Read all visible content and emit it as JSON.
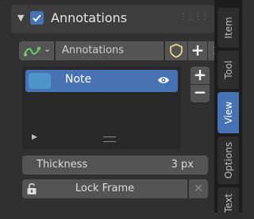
{
  "panel": {
    "title": "Annotations",
    "enabled": true
  },
  "datablock": {
    "name": "Annotations",
    "add_label": "+",
    "remove_label": "✕"
  },
  "layers": {
    "items": [
      {
        "name": "Note",
        "color": "#4e95c9",
        "selected": true,
        "visible": true
      }
    ],
    "add_label": "+",
    "remove_label": "−"
  },
  "thickness": {
    "label": "Thickness",
    "value": "3 px"
  },
  "lock_frame": {
    "label": "Lock Frame"
  },
  "tabs": [
    {
      "label": "Item",
      "active": false
    },
    {
      "label": "Tool",
      "active": false
    },
    {
      "label": "View",
      "active": true
    },
    {
      "label": "Options",
      "active": false
    },
    {
      "label": "Text",
      "active": false
    }
  ],
  "colors": {
    "accent": "#4772b3",
    "background": "#303030",
    "widget": "#545454",
    "list_bg": "#282828",
    "tab_bar": "#1d1d1d"
  }
}
